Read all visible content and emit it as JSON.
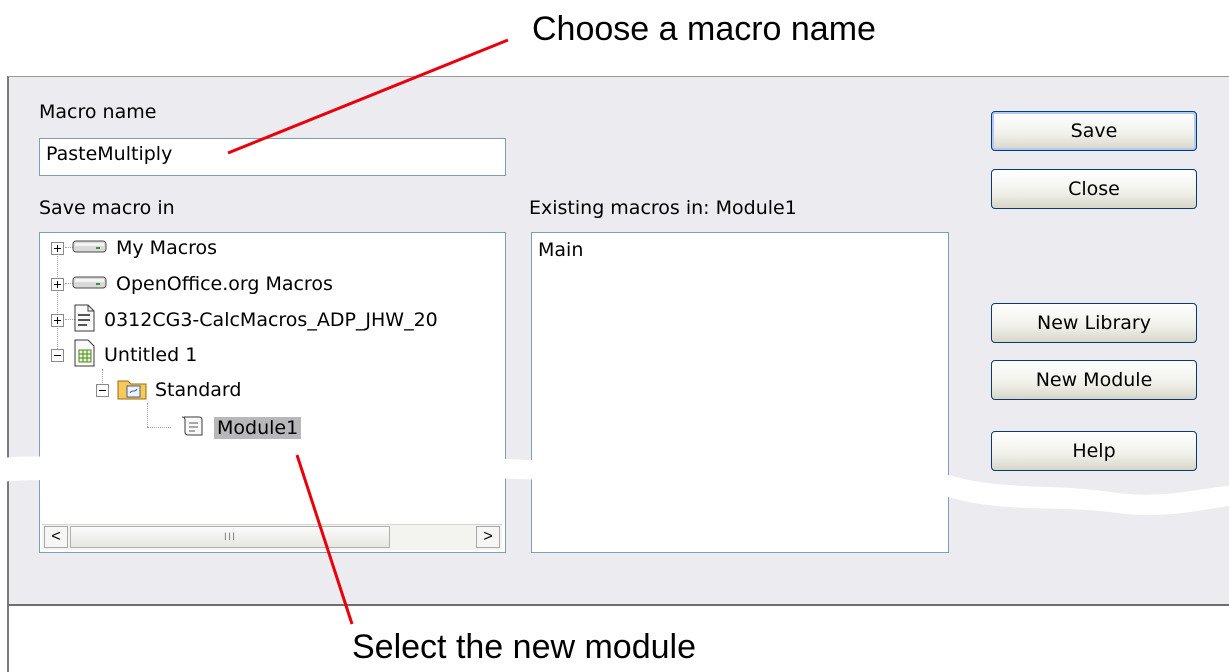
{
  "callouts": {
    "top": "Choose a macro name",
    "bottom": "Select the new module"
  },
  "dialog": {
    "macro_name_label": "Macro name",
    "macro_name_value": "PasteMultiply",
    "save_in_label": "Save macro in",
    "existing_label": "Existing macros in: Module1",
    "existing_items": [
      "Main"
    ],
    "tree": [
      {
        "label": "My Macros",
        "icon": "drive-icon",
        "expander": "plus"
      },
      {
        "label": "OpenOffice.org Macros",
        "icon": "drive-icon",
        "expander": "plus"
      },
      {
        "label": "0312CG3-CalcMacros_ADP_JHW_20",
        "icon": "document-icon",
        "expander": "plus"
      },
      {
        "label": "Untitled 1",
        "icon": "spreadsheet-icon",
        "expander": "minus"
      },
      {
        "label": "Standard",
        "icon": "library-folder-icon",
        "expander": "minus"
      },
      {
        "label": "Module1",
        "icon": "module-scroll-icon",
        "selected": true
      }
    ],
    "buttons": {
      "save": "Save",
      "close": "Close",
      "new_library": "New Library",
      "new_module": "New Module",
      "help": "Help"
    },
    "scrollbar": {
      "left": "<",
      "right": ">",
      "thumb": "III"
    }
  },
  "colors": {
    "dialog_bg": "#ececf0",
    "field_border": "#7f9db9",
    "button_border": "#003c74",
    "arrow": "#e8000b",
    "selection": "#b8b8bc"
  }
}
